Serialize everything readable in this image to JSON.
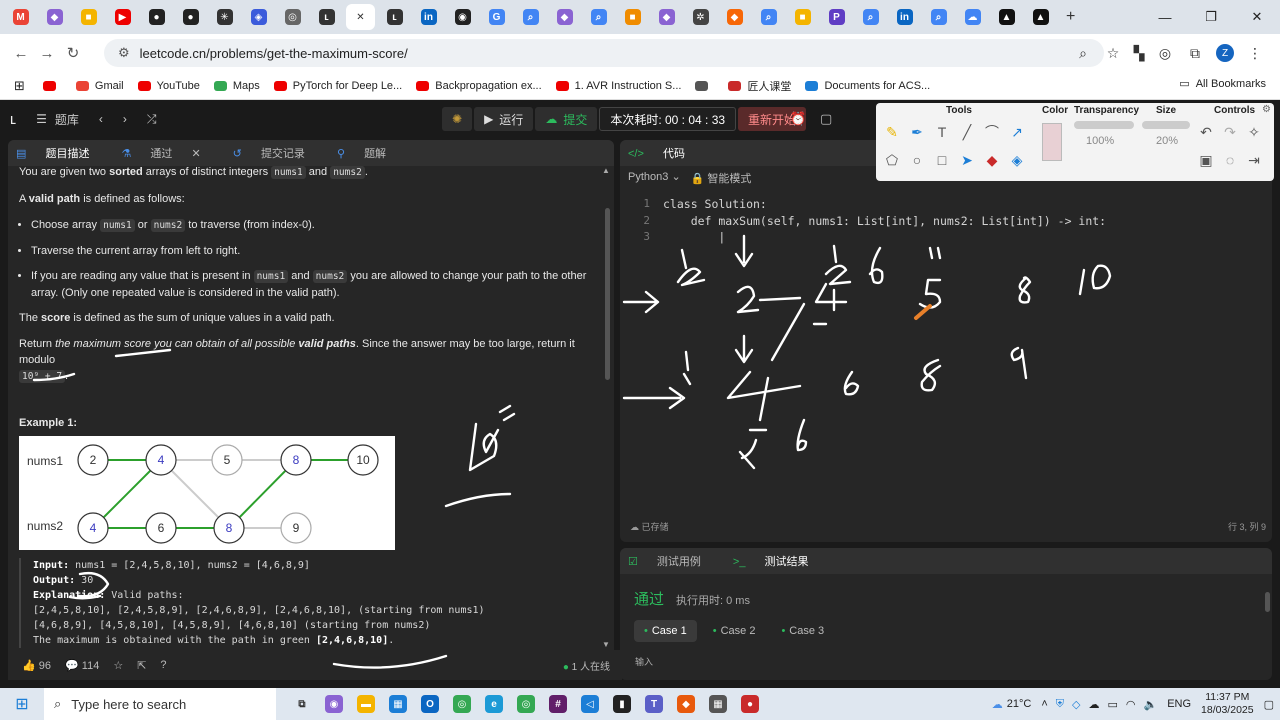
{
  "browser": {
    "url": "leetcode.cn/problems/get-the-maximum-score/",
    "profile_initial": "Z",
    "tabs": [
      {
        "icon": "gmail-icon",
        "glyph": "M",
        "color": "#ea4335"
      },
      {
        "icon": "app-icon",
        "glyph": "◆",
        "color": "#8a63d2"
      },
      {
        "icon": "app-icon",
        "glyph": "■",
        "color": "#f4b400"
      },
      {
        "icon": "youtube-icon",
        "glyph": "▶",
        "color": "#e00"
      },
      {
        "icon": "github-icon",
        "glyph": "●",
        "color": "#222"
      },
      {
        "icon": "github-icon",
        "glyph": "●",
        "color": "#222"
      },
      {
        "icon": "app-icon",
        "glyph": "✳",
        "color": "#333"
      },
      {
        "icon": "app-icon",
        "glyph": "◈",
        "color": "#3b5bdb"
      },
      {
        "icon": "globe-icon",
        "glyph": "◎",
        "color": "#666"
      },
      {
        "icon": "leetcode-icon",
        "glyph": "ʟ",
        "color": "#333"
      },
      {
        "icon": "close-icon",
        "glyph": "✕",
        "color": "#333",
        "active": true
      },
      {
        "icon": "leetcode-icon",
        "glyph": "ʟ",
        "color": "#333"
      },
      {
        "icon": "linkedin-icon",
        "glyph": "in",
        "color": "#0a66c2"
      },
      {
        "icon": "app-icon",
        "glyph": "◉",
        "color": "#222"
      },
      {
        "icon": "google-icon",
        "glyph": "G",
        "color": "#4285f4"
      },
      {
        "icon": "search-icon",
        "glyph": "⌕",
        "color": "#4285f4"
      },
      {
        "icon": "app-icon",
        "glyph": "◆",
        "color": "#8a63d2"
      },
      {
        "icon": "search-icon",
        "glyph": "⌕",
        "color": "#4285f4"
      },
      {
        "icon": "app-icon",
        "glyph": "■",
        "color": "#f08c00"
      },
      {
        "icon": "app-icon",
        "glyph": "◆",
        "color": "#8a63d2"
      },
      {
        "icon": "app-icon",
        "glyph": "✲",
        "color": "#444"
      },
      {
        "icon": "app-icon",
        "glyph": "◆",
        "color": "#f76707"
      },
      {
        "icon": "search-icon",
        "glyph": "⌕",
        "color": "#4285f4"
      },
      {
        "icon": "app-icon",
        "glyph": "■",
        "color": "#f4b400"
      },
      {
        "icon": "app-icon",
        "glyph": "P",
        "color": "#5f3dc4"
      },
      {
        "icon": "search-icon",
        "glyph": "⌕",
        "color": "#4285f4"
      },
      {
        "icon": "linkedin-icon",
        "glyph": "in",
        "color": "#0a66c2"
      },
      {
        "icon": "search-icon",
        "glyph": "⌕",
        "color": "#4285f4"
      },
      {
        "icon": "app-icon",
        "glyph": "☁",
        "color": "#4285f4"
      },
      {
        "icon": "app-icon",
        "glyph": "▲",
        "color": "#111"
      },
      {
        "icon": "app-icon",
        "glyph": "▲",
        "color": "#111"
      }
    ],
    "new_tab_symbol": "+",
    "bookmarks": [
      {
        "label": "",
        "color": "#e00"
      },
      {
        "label": "Gmail",
        "color": "#ea4335"
      },
      {
        "label": "YouTube",
        "color": "#e00"
      },
      {
        "label": "Maps",
        "color": "#34a853"
      },
      {
        "label": "PyTorch for Deep Le...",
        "color": "#e00"
      },
      {
        "label": "Backpropagation ex...",
        "color": "#e00"
      },
      {
        "label": "1. AVR Instruction S...",
        "color": "#e00"
      },
      {
        "label": "",
        "color": "#555"
      },
      {
        "label": "匠人课堂",
        "color": "#c92a2a"
      },
      {
        "label": "Documents for ACS...",
        "color": "#1c7ed6"
      }
    ],
    "all_bookmarks": "All Bookmarks"
  },
  "leetcode": {
    "problem_bank": "题库",
    "run": "运行",
    "submit": "提交",
    "timer": "本次耗时: 00 : 04 : 33",
    "restart": "重新开始",
    "left_tabs": [
      "题目描述",
      "通过",
      "提交记录",
      "题解"
    ],
    "description": {
      "intro_a": "You are given two ",
      "intro_b": "sorted",
      "intro_c": " arrays of distinct integers ",
      "nums1": "nums1",
      "and": " and ",
      "nums2": "nums2",
      "period": ".",
      "vp_a": "A ",
      "vp_b": "valid path",
      "vp_c": " is defined as follows:",
      "bullet1_a": "Choose array ",
      "bullet1_b": " or ",
      "bullet1_c": " to traverse (from index-0).",
      "bullet2": "Traverse the current array from left to right.",
      "bullet3_a": "If you are reading any value that is present in ",
      "bullet3_b": " and ",
      "bullet3_c": " you are allowed to change your path to the other array. (Only one repeated value is considered in the valid path).",
      "score_a": "The ",
      "score_b": "score",
      "score_c": " is defined as the sum of unique values in a valid path.",
      "ret_a": "Return ",
      "ret_b": "the maximum score you can obtain of all possible ",
      "ret_c": "valid paths",
      "ret_d": ". Since the answer may be too large, return it modulo",
      "modulo": "10⁹ + 7",
      "ex_title": "Example 1:"
    },
    "figure": {
      "row1_label": "nums1",
      "row2_label": "nums2",
      "nums1": [
        "2",
        "4",
        "5",
        "8",
        "10"
      ],
      "nums2": [
        "4",
        "6",
        "8",
        "9"
      ]
    },
    "example": {
      "input_label": "Input:",
      "input_val": " nums1 = [2,4,5,8,10], nums2 = [4,6,8,9]",
      "output_label": "Output:",
      "output_val": " 30",
      "expl_label": "Explanation:",
      "expl_val": " Valid paths:",
      "line1": "[2,4,5,8,10], [2,4,5,8,9], [2,4,6,8,9], [2,4,6,8,10],  (starting from nums1)",
      "line2": "[4,6,8,9], [4,5,8,10], [4,5,8,9], [4,6,8,10]    (starting from nums2)",
      "line3a": "The maximum is obtained with the path in green ",
      "line3b": "[2,4,6,8,10]",
      "line3c": "."
    },
    "footer": {
      "likes": "96",
      "comments": "114",
      "online": "1 人在线"
    },
    "code_tab": "代码",
    "language": "Python3",
    "smart_mode": "智能模式",
    "code_lines": [
      {
        "n": "1",
        "text": "class Solution:"
      },
      {
        "n": "2",
        "text": "    def maxSum(self, nums1: List[int], nums2: List[int]) -> int:"
      },
      {
        "n": "3",
        "text": "        |"
      }
    ],
    "saved": "已存储",
    "cursor_pos": "行 3, 列 9",
    "test_tabs": [
      "测试用例",
      "测试结果"
    ],
    "passed": "通过",
    "runtime": "执行用时: 0 ms",
    "cases": [
      "Case 1",
      "Case 2",
      "Case 3"
    ],
    "input_label": "输入"
  },
  "annotation_tool": {
    "tools_title": "Tools",
    "color_title": "Color",
    "transparency_title": "Transparency",
    "transparency_val": "100%",
    "size_title": "Size",
    "size_val": "20%",
    "controls_title": "Controls",
    "color": "#e8d0d4"
  },
  "taskbar": {
    "search_placeholder": "Type here to search",
    "weather": "21°C",
    "lang": "ENG",
    "time": "11:37 PM",
    "date": "18/03/2025"
  }
}
